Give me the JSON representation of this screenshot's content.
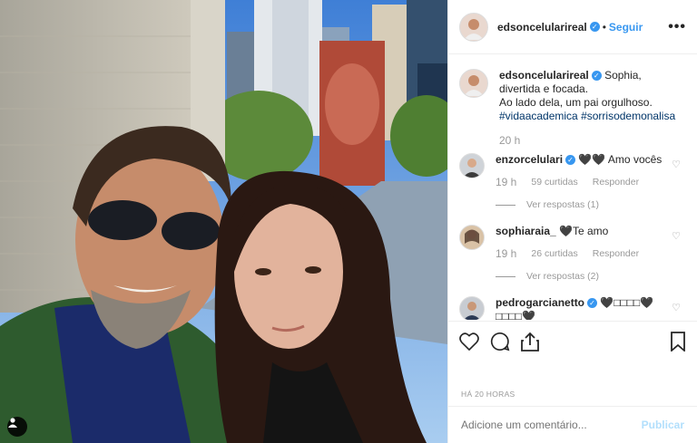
{
  "post": {
    "author": "edsoncelularireal",
    "follow_label": "Seguir",
    "dot": "•",
    "more_label": "•••",
    "caption_text": "Sophia, divertida e focada.",
    "caption_line2": "Ao lado dela, um pai orgulhoso.",
    "hashtags": [
      "#vidaacademica",
      "#sorrisodemonalisa"
    ],
    "caption_time": "20 h",
    "posted_ago": "HÁ 20 HORAS"
  },
  "comments": [
    {
      "user": "enzorcelulari",
      "verified": true,
      "text": "🖤🖤 Amo vocês",
      "time": "19 h",
      "likes": "59 curtidas",
      "reply_label": "Responder",
      "replies_label": "Ver respostas (1)"
    },
    {
      "user": "sophiaraia_",
      "verified": false,
      "text": "🖤Te amo",
      "time": "19 h",
      "likes": "26 curtidas",
      "reply_label": "Responder",
      "replies_label": "Ver respostas (2)"
    },
    {
      "user": "pedrogarcianetto",
      "verified": true,
      "text": "🖤□□□□🖤",
      "text2": "□□□□🖤"
    }
  ],
  "add_comment": {
    "placeholder": "Adicione um comentário...",
    "publish_label": "Publicar"
  },
  "icons": {
    "like": "heart-icon",
    "comment": "comment-icon",
    "share": "share-icon",
    "save": "bookmark-icon",
    "tag": "user-tag-icon"
  },
  "colors": {
    "link_blue": "#3897f0",
    "hashtag": "#003569",
    "muted": "#999999"
  }
}
